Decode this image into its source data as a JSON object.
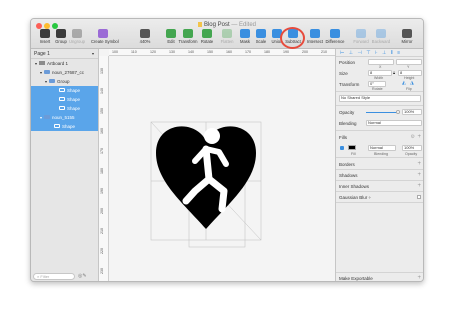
{
  "window": {
    "title": "Blog Post",
    "edited": "— Edited",
    "colors": {
      "accent": "#3a8fe0",
      "selection": "#5aa5ea",
      "highlight": "#e74b3c"
    }
  },
  "toolbar": [
    {
      "id": "insert",
      "label": "Insert",
      "icon": "insert-icon",
      "color": "#3c3c3c",
      "disabled": false
    },
    {
      "id": "group",
      "label": "Group",
      "icon": "group-icon",
      "color": "#3c3c3c",
      "disabled": false
    },
    {
      "id": "ungroup",
      "label": "Ungroup",
      "icon": "ungroup-icon",
      "color": "#3c3c3c",
      "disabled": true
    },
    {
      "id": "create-symbol",
      "label": "Create Symbol",
      "icon": "symbol-icon",
      "color": "#9b6bd6",
      "disabled": false
    },
    {
      "id": "zoom",
      "label": "440%",
      "icon": "zoom-icon",
      "color": "#555555",
      "disabled": false
    },
    {
      "id": "edit",
      "label": "Edit",
      "icon": "edit-icon",
      "color": "#44a650",
      "disabled": false
    },
    {
      "id": "transform",
      "label": "Transform",
      "icon": "transform-icon",
      "color": "#44a650",
      "disabled": false
    },
    {
      "id": "rotate",
      "label": "Rotate",
      "icon": "rotate-icon",
      "color": "#44a650",
      "disabled": false
    },
    {
      "id": "flatten",
      "label": "Flatten",
      "icon": "flatten-icon",
      "color": "#44a650",
      "disabled": true
    },
    {
      "id": "mask",
      "label": "Mask",
      "icon": "mask-icon",
      "color": "#3a8fe0",
      "disabled": false
    },
    {
      "id": "scale",
      "label": "Scale",
      "icon": "scale-icon",
      "color": "#3a8fe0",
      "disabled": false
    },
    {
      "id": "union",
      "label": "Union",
      "icon": "union-icon",
      "color": "#3a8fe0",
      "disabled": false
    },
    {
      "id": "subtract",
      "label": "Subtract",
      "icon": "subtract-icon",
      "color": "#3a8fe0",
      "disabled": false
    },
    {
      "id": "intersect",
      "label": "Intersect",
      "icon": "intersect-icon",
      "color": "#3a8fe0",
      "disabled": false
    },
    {
      "id": "difference",
      "label": "Difference",
      "icon": "difference-icon",
      "color": "#3a8fe0",
      "disabled": false
    },
    {
      "id": "forward",
      "label": "Forward",
      "icon": "forward-icon",
      "color": "#3a8fe0",
      "disabled": true
    },
    {
      "id": "backward",
      "label": "Backward",
      "icon": "backward-icon",
      "color": "#3a8fe0",
      "disabled": true
    },
    {
      "id": "mirror",
      "label": "Mirror",
      "icon": "mirror-icon",
      "color": "#555555",
      "disabled": false
    }
  ],
  "sidebar": {
    "page": "Page 1",
    "layers": [
      {
        "label": "Artboard 1",
        "icon": "artboard-icon",
        "indent": 0,
        "selected": false,
        "caret": "▾"
      },
      {
        "label": "noun_27687_cc",
        "icon": "folder-icon",
        "indent": 1,
        "selected": false,
        "caret": "▾"
      },
      {
        "label": "Group",
        "icon": "folder-icon",
        "indent": 2,
        "selected": false,
        "caret": "▾"
      },
      {
        "label": "Shape",
        "icon": "shape-icon",
        "indent": 4,
        "selected": true,
        "caret": ""
      },
      {
        "label": "Shape",
        "icon": "shape-icon",
        "indent": 4,
        "selected": true,
        "caret": ""
      },
      {
        "label": "Shape",
        "icon": "shape-icon",
        "indent": 4,
        "selected": true,
        "caret": ""
      },
      {
        "label": "noun_5155",
        "icon": "folder-icon",
        "indent": 1,
        "selected": true,
        "caret": "▾"
      },
      {
        "label": "Shape",
        "icon": "shape-icon",
        "indent": 3,
        "selected": true,
        "caret": ""
      }
    ],
    "filter_placeholder": "Filter"
  },
  "canvas": {
    "ruler_top": [
      "100",
      "110",
      "120",
      "130",
      "140",
      "150",
      "160",
      "170",
      "180",
      "190",
      "200",
      "210"
    ],
    "ruler_left": [
      "130",
      "140",
      "150",
      "160",
      "170",
      "180",
      "190",
      "200",
      "210",
      "220",
      "230"
    ]
  },
  "inspector": {
    "position_label": "Position",
    "x_label": "X",
    "y_label": "Y",
    "size_label": "Size",
    "size_w": "8",
    "size_h": "8",
    "width_label": "Width",
    "height_label": "Height",
    "transform_label": "Transform",
    "rotate_value": "0°",
    "rotate_label": "Rotate",
    "flip_label": "Flip",
    "shared_style": "No Shared Style",
    "opacity_label": "Opacity",
    "opacity_value": "100%",
    "blending_label": "Blending",
    "blending_value": "Normal",
    "fills_label": "Fills",
    "fill_color": "#000000",
    "fill_blending": "Normal",
    "fill_opacity": "100%",
    "fill_sub": "Fill",
    "fill_blend_sub": "Blending",
    "fill_opacity_sub": "Opacity",
    "borders_label": "Borders",
    "shadows_label": "Shadows",
    "inner_shadows_label": "Inner Shadows",
    "gaussian_label": "Gaussian Blur ÷",
    "exportable_label": "Make Exportable"
  }
}
